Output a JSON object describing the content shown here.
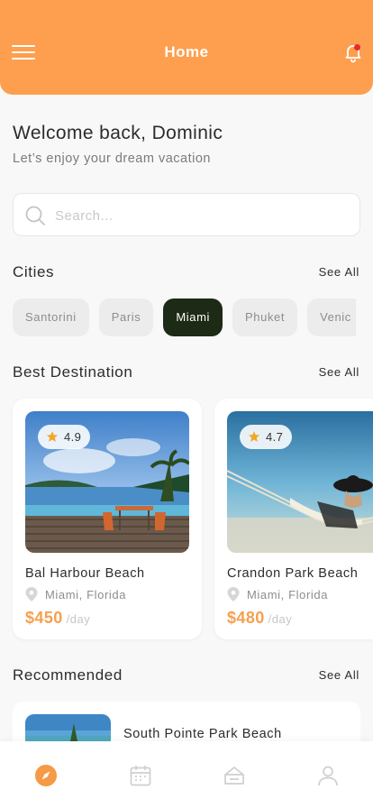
{
  "header": {
    "title": "Home",
    "background_color": "#fd9f4e",
    "menu_icon": "hamburger-menu-icon",
    "notification_icon": "bell-icon",
    "has_unread_notification": true
  },
  "welcome": {
    "title": "Welcome back, Dominic",
    "subtitle": "Let’s enjoy your dream vacation"
  },
  "search": {
    "placeholder": "Search...",
    "value": "",
    "icon": "search-icon"
  },
  "cities": {
    "title": "Cities",
    "see_all": "See All",
    "items": [
      {
        "label": "Santorini",
        "active": false
      },
      {
        "label": "Paris",
        "active": false
      },
      {
        "label": "Miami",
        "active": true
      },
      {
        "label": "Phuket",
        "active": false
      },
      {
        "label": "Venic",
        "active": false
      }
    ]
  },
  "best_destination": {
    "title": "Best Destination",
    "see_all": "See All",
    "items": [
      {
        "rating": "4.9",
        "name": "Bal Harbour Beach",
        "location": "Miami, Florida",
        "price": "$450",
        "per": "/day"
      },
      {
        "rating": "4.7",
        "name": "Crandon Park Beach",
        "location": "Miami, Florida",
        "price": "$480",
        "per": "/day"
      }
    ]
  },
  "recommended": {
    "title": "Recommended",
    "see_all": "See All",
    "items": [
      {
        "name": "South Pointe Park Beach"
      }
    ]
  },
  "tabbar": {
    "items": [
      {
        "icon": "compass-icon",
        "active": true
      },
      {
        "icon": "calendar-icon",
        "active": false
      },
      {
        "icon": "ticket-icon",
        "active": false
      },
      {
        "icon": "profile-icon",
        "active": false
      }
    ]
  },
  "colors": {
    "accent": "#fd9f4e",
    "price": "#f5a04f",
    "active_chip": "#1d2a16",
    "star": "#f5a623"
  }
}
